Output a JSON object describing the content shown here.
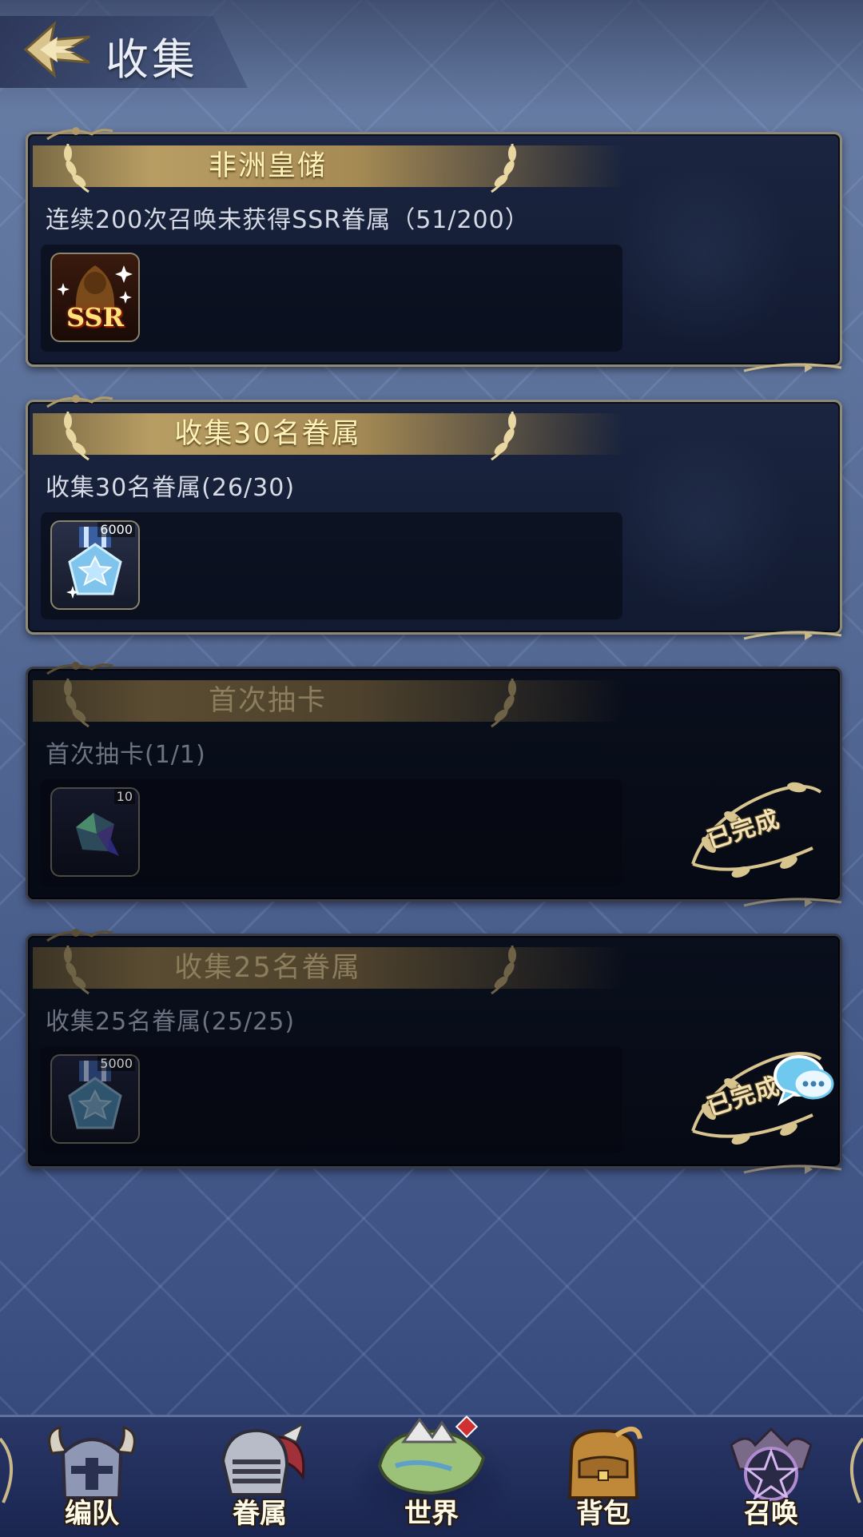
{
  "header": {
    "title": "收集"
  },
  "achievements": [
    {
      "title": "非洲皇储",
      "desc": "连续200次召唤未获得SSR眷属（51/200）",
      "reward_label": "SSR",
      "reward_count": "",
      "completed": false
    },
    {
      "title": "收集30名眷属",
      "desc": "收集30名眷属(26/30)",
      "reward_label": "",
      "reward_count": "6000",
      "completed": false
    },
    {
      "title": "首次抽卡",
      "desc": "首次抽卡(1/1)",
      "reward_label": "",
      "reward_count": "10",
      "completed": true,
      "stamp": "已完成"
    },
    {
      "title": "收集25名眷属",
      "desc": "收集25名眷属(25/25)",
      "reward_label": "",
      "reward_count": "5000",
      "completed": true,
      "stamp": "已完成"
    }
  ],
  "bottom_nav": {
    "items": [
      {
        "label": "编队",
        "icon": "helmet-icon"
      },
      {
        "label": "眷属",
        "icon": "knight-helmet-icon"
      },
      {
        "label": "世界",
        "icon": "world-map-icon",
        "active": true
      },
      {
        "label": "背包",
        "icon": "backpack-icon"
      },
      {
        "label": "召唤",
        "icon": "summon-pentagram-icon"
      }
    ]
  },
  "colors": {
    "gold": "#b89d63",
    "title_text": "#fff3b8",
    "background": "#5a6f99"
  }
}
